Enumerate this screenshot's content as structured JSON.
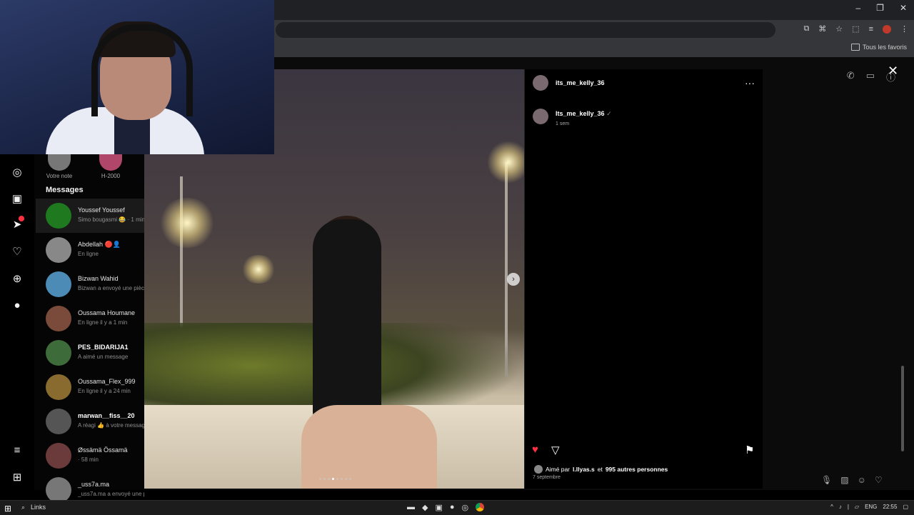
{
  "browser": {
    "window_controls": [
      "–",
      "❐",
      "✕"
    ],
    "bookmarks_label": "Tous les favoris",
    "toolbar_icons": [
      "install-icon",
      "translate-icon",
      "star-icon",
      "extensions-icon",
      "media-icon",
      "profile-avatar",
      "more-icon"
    ]
  },
  "ig_nav": {
    "icons": [
      "compass-icon",
      "reels-icon",
      "messenger-icon",
      "heart-icon",
      "create-icon",
      "profile-icon",
      "menu-icon",
      "threads-icon"
    ]
  },
  "notes": [
    {
      "label": "Votre note"
    },
    {
      "label": "H-2000"
    }
  ],
  "messages": {
    "heading": "Messages",
    "threads": [
      {
        "name": "Youssef Youssef",
        "sub": "Simo bougasmi 😂 · 1 min",
        "bold": false,
        "color": "#1f7a1f"
      },
      {
        "name": "Abdellah 🔴👤",
        "sub": "En ligne",
        "bold": false,
        "color": "#888888"
      },
      {
        "name": "Bizwan Wahid",
        "sub": "Bizwan a envoyé une pièce",
        "bold": false,
        "color": "#4c8bb5"
      },
      {
        "name": "Oussama Houmane",
        "sub": "En ligne il y a 1 min",
        "bold": false,
        "color": "#7a4b3a"
      },
      {
        "name": "PES_BIDARIJA1",
        "sub": "A aimé un message",
        "bold": true,
        "color": "#3e6b3a"
      },
      {
        "name": "Oussama_Flex_999",
        "sub": "En ligne il y a 24 min",
        "bold": false,
        "color": "#8a6b2f"
      },
      {
        "name": "marwan__fiss__20",
        "sub": "A réagi 👍 à votre message",
        "bold": true,
        "color": "#555555"
      },
      {
        "name": "Øssämä Össamä",
        "sub": "· 58 min",
        "bold": false,
        "color": "#6b3a3a"
      },
      {
        "name": "_uss7a.ma",
        "sub": "_uss7a.ma a envoyé une photo · 1 h",
        "bold": false,
        "color": "#777777"
      }
    ]
  },
  "post": {
    "username": "its_me_kelly_36",
    "caption_user": "Its_me_kelly_36",
    "verified_mark": "✓",
    "caption_time": "1 sem",
    "more": "···",
    "liked_prefix": "Aimé par",
    "liked_user": "l.llyas.s",
    "liked_conj": "et",
    "liked_others": "995 autres personnes",
    "date": "7 septembre",
    "carousel_count": 8,
    "carousel_active": 3,
    "icons": {
      "like": "heart-filled-icon",
      "share": "send-icon",
      "save": "bookmark-icon",
      "next": "chevron-right-icon"
    },
    "colors": {
      "like": "#ff3040"
    }
  },
  "chat": {
    "header_icons": [
      "phone-icon",
      "video-icon",
      "info-icon"
    ],
    "input_icons": [
      "mic-icon",
      "image-icon",
      "sticker-icon",
      "heart-icon"
    ]
  },
  "taskbar": {
    "search_label": "Links",
    "language": "ENG",
    "time": "22:55"
  }
}
